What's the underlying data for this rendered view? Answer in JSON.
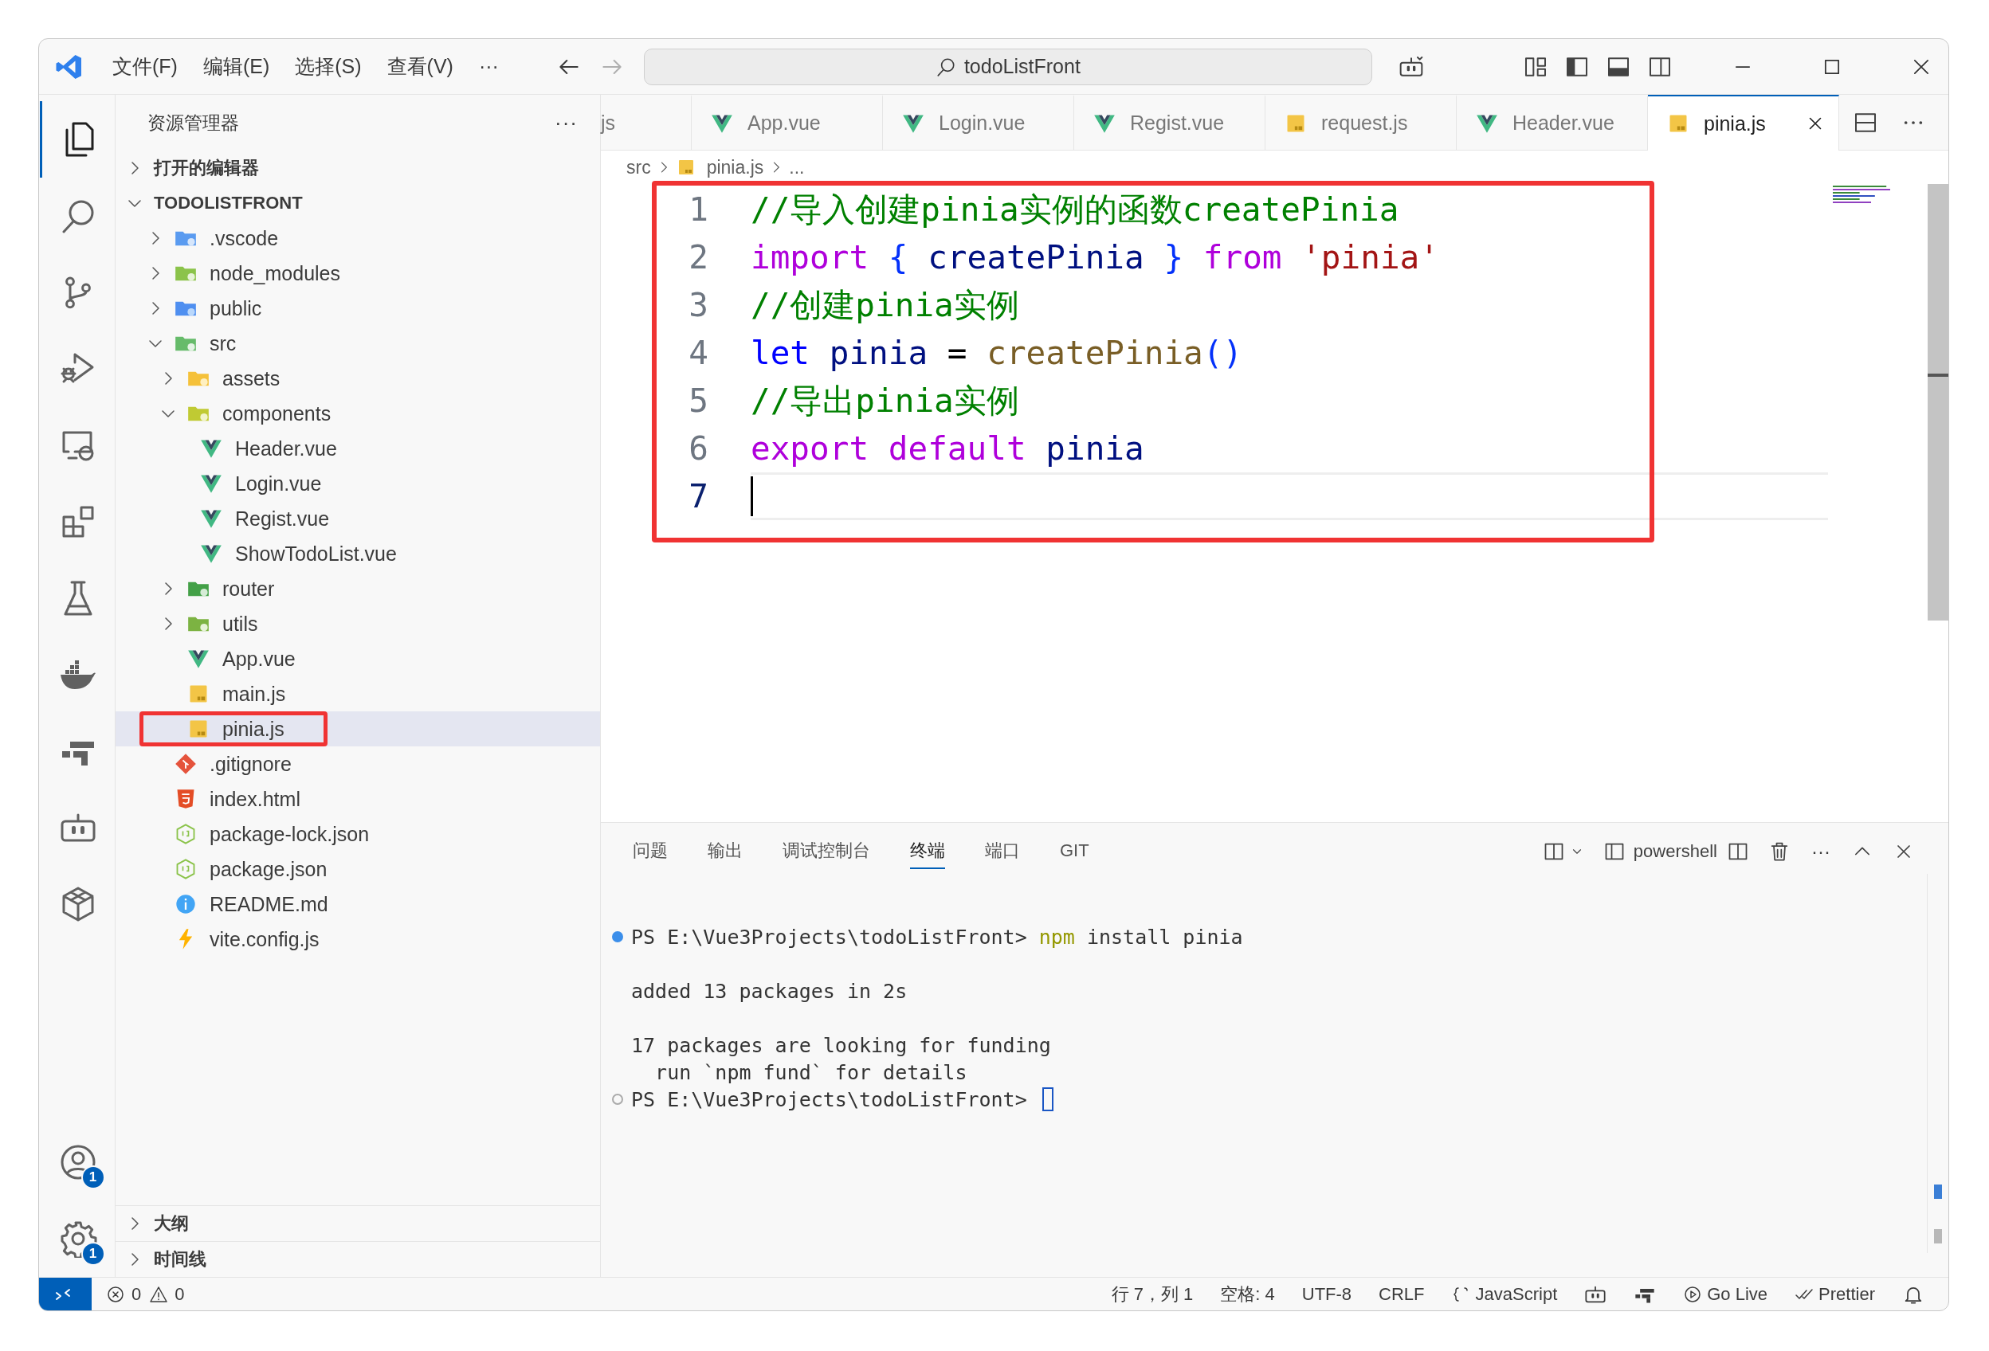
{
  "title_bar": {
    "menus": [
      {
        "label": "文件(F)"
      },
      {
        "label": "编辑(E)"
      },
      {
        "label": "选择(S)"
      },
      {
        "label": "查看(V)"
      }
    ],
    "more": "···",
    "command_center": "todoListFront"
  },
  "activity_bar": {
    "items": [
      {
        "kind": "explorer",
        "selected": true
      },
      {
        "kind": "search",
        "selected": false
      },
      {
        "kind": "source-control",
        "selected": false
      },
      {
        "kind": "run-debug",
        "selected": false
      },
      {
        "kind": "remote",
        "selected": false
      },
      {
        "kind": "extensions",
        "selected": false
      },
      {
        "kind": "testing",
        "selected": false
      },
      {
        "kind": "docker",
        "selected": false
      },
      {
        "kind": "blocks",
        "selected": false
      },
      {
        "kind": "robot",
        "selected": false
      },
      {
        "kind": "cube",
        "selected": false
      }
    ],
    "bottom": [
      {
        "kind": "account",
        "badge": "1"
      },
      {
        "kind": "settings",
        "badge": "1"
      }
    ]
  },
  "sidebar": {
    "title": "资源管理器",
    "more": "···",
    "open_editors": {
      "label": "打开的编辑器",
      "expanded": false
    },
    "project": {
      "label": "TODOLISTFRONT",
      "expanded": true,
      "tree": [
        {
          "name": ".vscode",
          "kind": "folder-vscode",
          "expanded": false,
          "selected": false,
          "annotated": false
        },
        {
          "name": "node_modules",
          "kind": "folder-node",
          "expanded": false,
          "selected": false,
          "annotated": false
        },
        {
          "name": "public",
          "kind": "folder-public",
          "expanded": false,
          "selected": false,
          "annotated": false
        },
        {
          "name": "src",
          "kind": "folder-src",
          "expanded": true,
          "selected": false,
          "annotated": false,
          "children": [
            {
              "name": "assets",
              "kind": "folder-assets",
              "expanded": false,
              "selected": false,
              "annotated": false
            },
            {
              "name": "components",
              "kind": "folder-components",
              "expanded": true,
              "selected": false,
              "annotated": false,
              "children": [
                {
                  "name": "Header.vue",
                  "kind": "vue",
                  "selected": false,
                  "annotated": false
                },
                {
                  "name": "Login.vue",
                  "kind": "vue",
                  "selected": false,
                  "annotated": false
                },
                {
                  "name": "Regist.vue",
                  "kind": "vue",
                  "selected": false,
                  "annotated": false
                },
                {
                  "name": "ShowTodoList.vue",
                  "kind": "vue",
                  "selected": false,
                  "annotated": false
                }
              ]
            },
            {
              "name": "router",
              "kind": "folder-router",
              "expanded": false,
              "selected": false,
              "annotated": false
            },
            {
              "name": "utils",
              "kind": "folder-utils",
              "expanded": false,
              "selected": false,
              "annotated": false
            },
            {
              "name": "App.vue",
              "kind": "vue",
              "selected": false,
              "annotated": false
            },
            {
              "name": "main.js",
              "kind": "js",
              "selected": false,
              "annotated": false
            },
            {
              "name": "pinia.js",
              "kind": "js",
              "selected": true,
              "annotated": true
            }
          ]
        },
        {
          "name": ".gitignore",
          "kind": "git",
          "selected": false,
          "annotated": false
        },
        {
          "name": "index.html",
          "kind": "html",
          "selected": false,
          "annotated": false
        },
        {
          "name": "package-lock.json",
          "kind": "json",
          "selected": false,
          "annotated": false
        },
        {
          "name": "package.json",
          "kind": "json",
          "selected": false,
          "annotated": false
        },
        {
          "name": "README.md",
          "kind": "info",
          "selected": false,
          "annotated": false
        },
        {
          "name": "vite.config.js",
          "kind": "vite",
          "selected": false,
          "annotated": false
        }
      ]
    },
    "bottom_sections": [
      {
        "label": "大纲",
        "expanded": false
      },
      {
        "label": "时间线",
        "expanded": false
      }
    ]
  },
  "tabs": [
    {
      "label": "js",
      "selected": false
    },
    {
      "label": "App.vue",
      "kind": "vue",
      "selected": false
    },
    {
      "label": "Login.vue",
      "kind": "vue",
      "selected": false
    },
    {
      "label": "Regist.vue",
      "kind": "vue",
      "selected": false
    },
    {
      "label": "request.js",
      "kind": "js",
      "selected": false
    },
    {
      "label": "Header.vue",
      "kind": "vue",
      "selected": false
    },
    {
      "label": "pinia.js",
      "kind": "js",
      "selected": true
    }
  ],
  "editor": {
    "breadcrumb": [
      {
        "label": "src"
      },
      {
        "label": "pinia.js",
        "kind": "js"
      },
      {
        "label": "..."
      }
    ],
    "annotated": true,
    "lines": [
      {
        "number": "1",
        "current": false,
        "tokens": [
          {
            "kind": "comment",
            "text": "//导入创建pinia实例的函数createPinia"
          }
        ]
      },
      {
        "number": "2",
        "current": false,
        "tokens": [
          {
            "kind": "keyword",
            "text": "import "
          },
          {
            "kind": "bracket",
            "text": "{ "
          },
          {
            "kind": "variable",
            "text": "createPinia "
          },
          {
            "kind": "bracket",
            "text": "} "
          },
          {
            "kind": "keyword",
            "text": "from "
          },
          {
            "kind": "string",
            "text": "'pinia'"
          }
        ]
      },
      {
        "number": "3",
        "current": false,
        "tokens": [
          {
            "kind": "comment",
            "text": "//创建pinia实例"
          }
        ]
      },
      {
        "number": "4",
        "current": false,
        "tokens": [
          {
            "kind": "storage",
            "text": "let "
          },
          {
            "kind": "variable",
            "text": "pinia"
          },
          {
            "kind": "plain",
            "text": " = "
          },
          {
            "kind": "function",
            "text": "createPinia"
          },
          {
            "kind": "bracket",
            "text": "()"
          }
        ]
      },
      {
        "number": "5",
        "current": false,
        "tokens": [
          {
            "kind": "comment",
            "text": "//导出pinia实例"
          }
        ]
      },
      {
        "number": "6",
        "current": false,
        "tokens": [
          {
            "kind": "keyword",
            "text": "export default "
          },
          {
            "kind": "variable",
            "text": "pinia"
          }
        ]
      },
      {
        "number": "7",
        "current": true
      }
    ]
  },
  "panel": {
    "tabs": [
      {
        "label": "问题",
        "selected": false
      },
      {
        "label": "输出",
        "selected": false
      },
      {
        "label": "调试控制台",
        "selected": false
      },
      {
        "label": "终端",
        "selected": true
      },
      {
        "label": "端口",
        "selected": false
      },
      {
        "label": "GIT",
        "selected": false
      }
    ],
    "profile": "powershell",
    "more": "···",
    "terminal": [
      {
        "lines": [
          {
            "kind": "command",
            "succeeded": true,
            "cursor": false,
            "segments": [
              {
                "kind": "plain",
                "text": "PS E:\\Vue3Projects\\todoListFront> "
              },
              {
                "kind": "command",
                "text": "npm"
              },
              {
                "kind": "plain",
                "text": " install pinia"
              }
            ]
          }
        ]
      },
      {
        "lines": [
          {
            "kind": "output",
            "cursor": false,
            "segments": [
              {
                "kind": "plain",
                "text": "added 13 packages in 2s"
              }
            ]
          }
        ]
      },
      {
        "lines": [
          {
            "kind": "output",
            "cursor": false,
            "segments": [
              {
                "kind": "plain",
                "text": "17 packages are looking for funding"
              }
            ]
          },
          {
            "kind": "output",
            "cursor": false,
            "segments": [
              {
                "kind": "plain",
                "text": "  run `npm fund` for details"
              }
            ]
          },
          {
            "kind": "command",
            "succeeded": false,
            "cursor": true,
            "segments": [
              {
                "kind": "plain",
                "text": "PS E:\\Vue3Projects\\todoListFront> "
              }
            ]
          }
        ]
      }
    ]
  },
  "status_bar": {
    "errors": "0",
    "warnings": "0",
    "items": [
      {
        "kind": "text",
        "text": "行 7，列 1"
      },
      {
        "kind": "text",
        "text": "空格: 4"
      },
      {
        "kind": "text",
        "text": "UTF-8"
      },
      {
        "kind": "text",
        "text": "CRLF"
      },
      {
        "kind": "language",
        "text": "JavaScript"
      },
      {
        "kind": "copilot"
      },
      {
        "kind": "blocks"
      },
      {
        "kind": "golive",
        "text": "Go Live"
      },
      {
        "kind": "prettier",
        "text": "Prettier"
      },
      {
        "kind": "bell"
      }
    ]
  }
}
